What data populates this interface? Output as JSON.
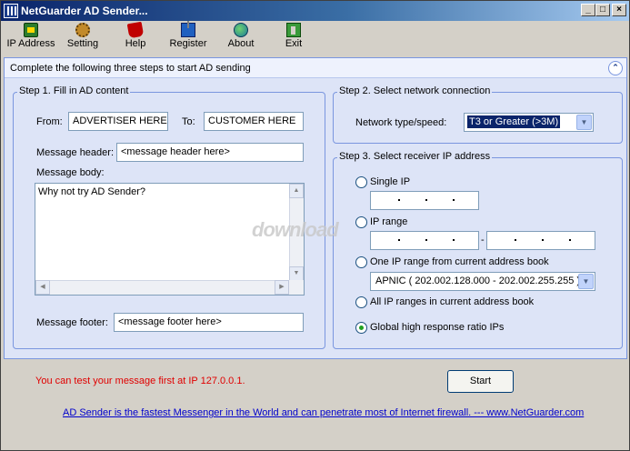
{
  "window": {
    "title": "NetGuarder AD Sender...",
    "controls": {
      "minimize": "_",
      "maximize": "□",
      "close": "×"
    }
  },
  "toolbar": {
    "items": [
      {
        "label": "IP Address",
        "icon": "lock-icon"
      },
      {
        "label": "Setting",
        "icon": "gear-icon"
      },
      {
        "label": "Help",
        "icon": "book-icon"
      },
      {
        "label": "Register",
        "icon": "register-icon"
      },
      {
        "label": "About",
        "icon": "globe-icon"
      },
      {
        "label": "Exit",
        "icon": "exit-door-icon"
      }
    ]
  },
  "panel": {
    "header": "Complete the following three steps to start AD sending",
    "collapse_glyph": "⌃"
  },
  "step1": {
    "legend": "Step 1. Fill in AD content",
    "from_label": "From:",
    "from_value": "ADVERTISER HERE",
    "to_label": "To:",
    "to_value": "CUSTOMER HERE",
    "header_label": "Message header:",
    "header_value": "<message header here>",
    "body_label": "Message body:",
    "body_value": "Why not try AD Sender?",
    "footer_label": "Message footer:",
    "footer_value": "<message footer here>"
  },
  "step2": {
    "legend": "Step 2. Select network connection",
    "network_label": "Network type/speed:",
    "network_value": "T3 or Greater (>3M)"
  },
  "step3": {
    "legend": "Step 3. Select receiver IP address",
    "options": [
      {
        "label": "Single IP",
        "checked": false
      },
      {
        "label": "IP range",
        "checked": false
      },
      {
        "label": "One IP range from current address book",
        "checked": false
      },
      {
        "label": "All IP ranges in current address book",
        "checked": false
      },
      {
        "label": "Global high response ratio IPs",
        "checked": true
      }
    ],
    "range_separator": "-",
    "addressbook_value": "APNIC ( 202.002.128.000 - 202.002.255.255 )"
  },
  "watermark": "download",
  "test_message": "You can test your message first at IP 127.0.0.1.",
  "start_label": "Start",
  "footer_link": "AD Sender is the fastest Messenger in the World and can penetrate most of Internet firewall. --- www.NetGuarder.com"
}
